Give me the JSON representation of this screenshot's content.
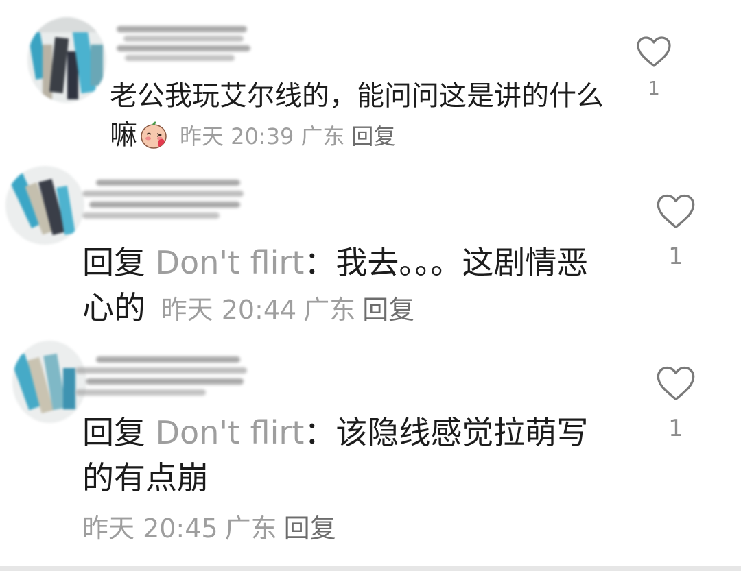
{
  "comments": [
    {
      "text": "老公我玩艾尔线的，能问问这是讲的什么嘛",
      "emoji": "blushing-kiss-emoji",
      "time": "昨天 20:39",
      "location": "广东",
      "reply_label": "回复",
      "likes": "1"
    },
    {
      "prefix": "回复",
      "reply_to": "Don't flirt",
      "colon": "：",
      "text": "我去。。。这剧情恶心的",
      "time": "昨天 20:44",
      "location": "广东",
      "reply_label": "回复",
      "likes": "1"
    },
    {
      "prefix": "回复",
      "reply_to": "Don't flirt",
      "colon": "：",
      "text": "该隐线感觉拉萌写的有点崩",
      "time": "昨天 20:45",
      "location": "广东",
      "reply_label": "回复",
      "likes": "1"
    }
  ],
  "colors": {
    "text": "#1c1c1c",
    "meta": "#9e9e9e",
    "heart": "#7a7a7a"
  }
}
